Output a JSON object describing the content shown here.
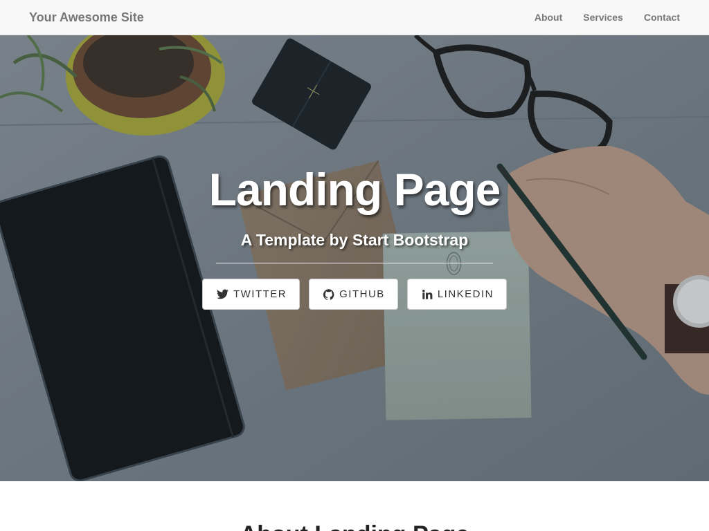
{
  "navbar": {
    "brand": "Your Awesome Site",
    "links": [
      "About",
      "Services",
      "Contact"
    ]
  },
  "hero": {
    "title": "Landing Page",
    "subtitle": "A Template by Start Bootstrap",
    "buttons": [
      {
        "label": "Twitter",
        "icon": "twitter-icon"
      },
      {
        "label": "Github",
        "icon": "github-icon"
      },
      {
        "label": "Linkedin",
        "icon": "linkedin-icon"
      }
    ]
  },
  "about": {
    "heading": "About Landing Page"
  },
  "colors": {
    "navbar_bg": "#f8f8f8",
    "nav_text": "#777777",
    "hero_text": "#ffffff",
    "button_bg": "#ffffff",
    "button_text": "#333333"
  }
}
